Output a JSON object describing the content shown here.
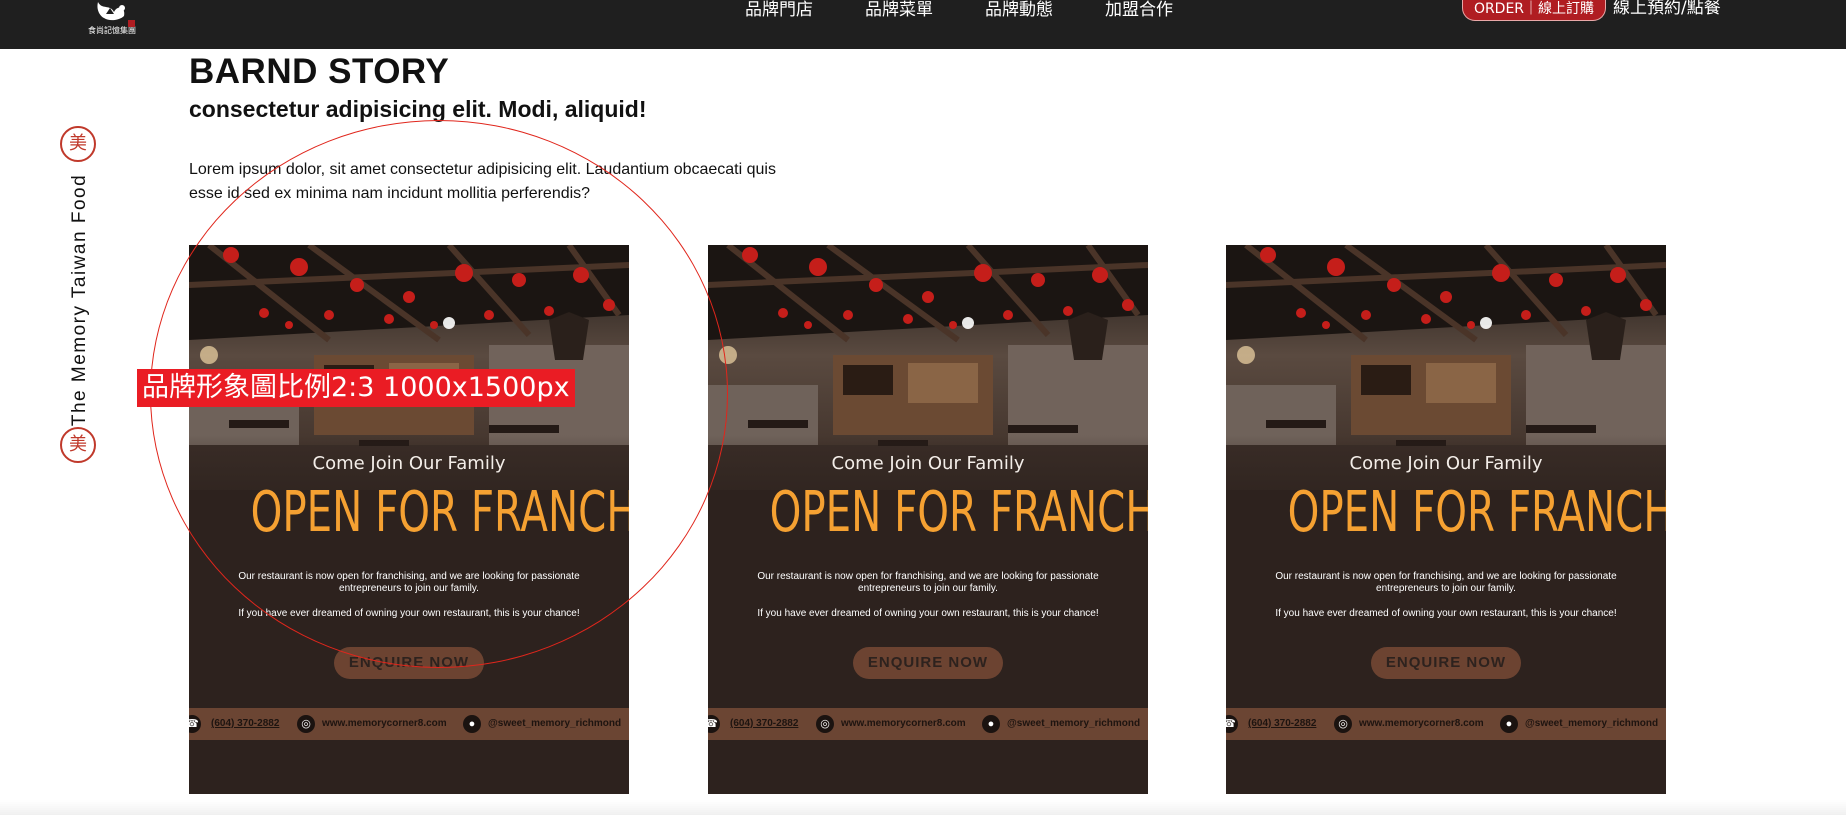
{
  "nav": {
    "logo_text": "食尚記憶集團",
    "links": [
      "品牌門店",
      "品牌菜單",
      "品牌動態",
      "加盟合作"
    ],
    "order_button": "ORDER｜線上訂購",
    "reserve_link": "線上預約/點餐"
  },
  "side": {
    "seal_char": "美",
    "label": "The Memory Taiwan Food"
  },
  "brand": {
    "title": "BARND STORY",
    "subtitle": "consectetur adipisicing elit. Modi, aliquid!",
    "body": "Lorem ipsum dolor, sit amet consectetur adipisicing elit. Laudantium obcaecati quis esse id sed ex minima nam incidunt mollitia perferendis?"
  },
  "card": {
    "tagline": "Come Join Our Family",
    "headline": "OPEN FOR FRANCHISE",
    "body_1": "Our restaurant is now open for franchising, and we are looking for passionate entrepreneurs to join our family.",
    "body_2": "If you have ever dreamed of owning your own restaurant, this is your chance!",
    "cta": "ENQUIRE NOW",
    "phone": "(604) 370-2882",
    "website": "www.memorycorner8.com",
    "instagram": "@sweet_memory_richmond"
  },
  "annotation": {
    "label": "品牌形象圖比例2:3  1000x1500px",
    "color": "#ea1c24"
  },
  "colors": {
    "navbar": "#1f1f1f",
    "accent_red": "#b01d22",
    "card_bg": "#2d221e",
    "headline_orange": "#f5a132",
    "footer_brown": "#6b4533"
  }
}
